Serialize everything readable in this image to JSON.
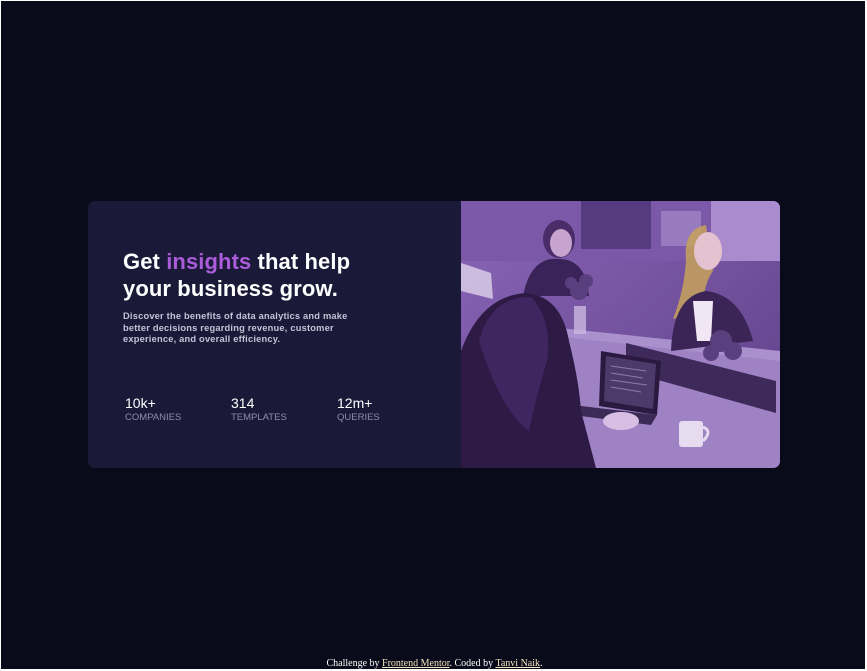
{
  "card": {
    "headline": {
      "before": "Get ",
      "accent": "insights",
      "after": " that help your business grow."
    },
    "description": "Discover the benefits of data analytics and make better decisions regarding revenue, customer experience, and overall efficiency.",
    "stats": [
      {
        "value": "10k+",
        "label": "COMPANIES"
      },
      {
        "value": "314",
        "label": "TEMPLATES"
      },
      {
        "value": "12m+",
        "label": "QUERIES"
      }
    ],
    "image": {
      "icon": "team-meeting-photo",
      "overlay_color": "#aa5cdb"
    }
  },
  "attribution": {
    "prefix": "Challenge by ",
    "link1": "Frontend Mentor",
    "middle": ". Coded by ",
    "link2": "Tanvi Naik",
    "suffix": "."
  },
  "colors": {
    "page_background": "#090b1a",
    "card_background": "#1b1938",
    "accent": "#aa5cdb"
  }
}
